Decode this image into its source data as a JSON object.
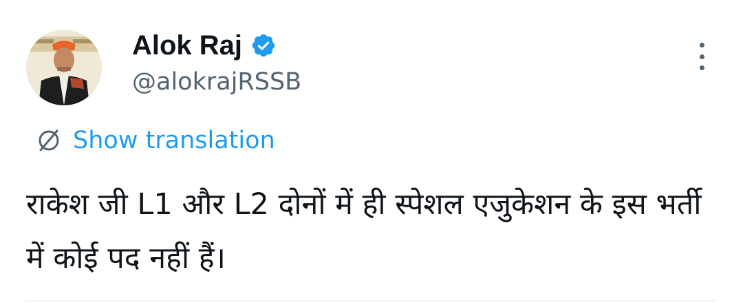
{
  "author": {
    "display_name": "Alok Raj",
    "handle": "@alokrajRSSB",
    "avatar_icon": "profile-photo",
    "verified_icon": "verified-badge-icon"
  },
  "translate": {
    "icon": "globe-translate-icon",
    "label": "Show translation"
  },
  "tweet": {
    "text": "राकेश जी L1 और L2 दोनों में ही स्पेशल एजुकेशन के इस भर्ती में कोई पद नहीं हैं।"
  },
  "menu": {
    "icon": "more-vertical-icon"
  },
  "colors": {
    "text": "#0f1419",
    "secondary": "#536471",
    "accent": "#1d9bf0",
    "divider": "#eff3f4"
  }
}
